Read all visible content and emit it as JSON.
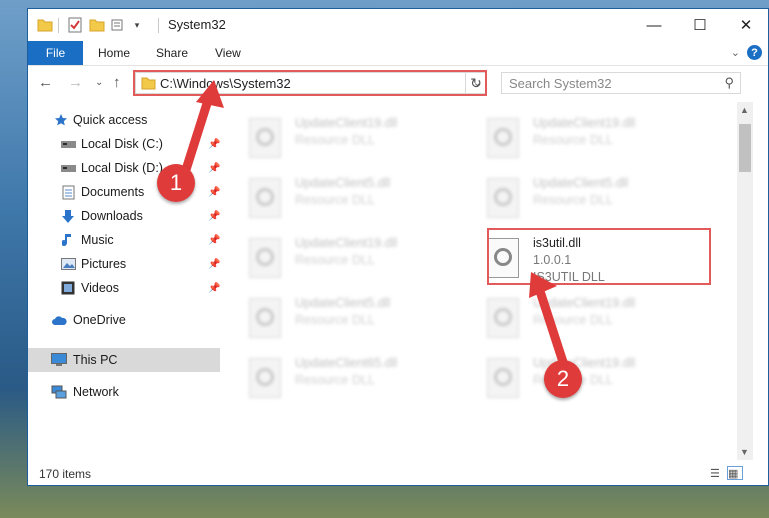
{
  "window": {
    "title": "System32",
    "controls": {
      "minimize": "—",
      "maximize": "☐",
      "close": "✕"
    }
  },
  "ribbon": {
    "file_tab": "File",
    "tabs": [
      "Home",
      "Share",
      "View"
    ]
  },
  "address_bar": {
    "path": "C:\\Windows\\System32",
    "search_placeholder": "Search System32"
  },
  "sidebar": {
    "items": [
      {
        "label": "Quick access",
        "icon": "star-icon",
        "pinned": false
      },
      {
        "label": "Local Disk (C:)",
        "icon": "drive-icon",
        "pinned": true
      },
      {
        "label": "Local Disk (D:)",
        "icon": "drive-icon",
        "pinned": true
      },
      {
        "label": "Documents",
        "icon": "documents-icon",
        "pinned": true
      },
      {
        "label": "Downloads",
        "icon": "download-arrow-icon",
        "pinned": true
      },
      {
        "label": "Music",
        "icon": "music-note-icon",
        "pinned": true
      },
      {
        "label": "Pictures",
        "icon": "pictures-icon",
        "pinned": true
      },
      {
        "label": "Videos",
        "icon": "videos-icon",
        "pinned": true
      },
      {
        "label": "OneDrive",
        "icon": "cloud-icon",
        "pinned": false
      },
      {
        "label": "This PC",
        "icon": "monitor-icon",
        "pinned": false,
        "selected": true
      },
      {
        "label": "Network",
        "icon": "network-icon",
        "pinned": false
      }
    ]
  },
  "files": {
    "left": [
      {
        "name": "UpdateClient19.dll",
        "type": "Resource DLL"
      },
      {
        "name": "UpdateClient5.dll",
        "type": "Resource DLL"
      },
      {
        "name": "UpdateClient19.dll",
        "type": "Resource DLL"
      },
      {
        "name": "UpdateClient5.dll",
        "type": "Resource DLL"
      },
      {
        "name": "UpdateClient65.dll",
        "type": "Resource DLL"
      }
    ],
    "right": [
      {
        "name": "UpdateClient19.dll",
        "type": "Resource DLL"
      },
      {
        "name": "UpdateClient5.dll",
        "type": "Resource DLL"
      },
      {
        "name": "UpdateClient19.dll",
        "type": "Resource DLL"
      },
      {
        "name": "UpdateClient19.dll",
        "type": "Resource DLL"
      }
    ],
    "highlighted": {
      "name": "is3util.dll",
      "version": "1.0.0.1",
      "type": "IS3UTIL DLL"
    }
  },
  "status": {
    "item_count": "170 items"
  },
  "annotations": {
    "step1": "1",
    "step2": "2",
    "color": "#e03b3b"
  }
}
